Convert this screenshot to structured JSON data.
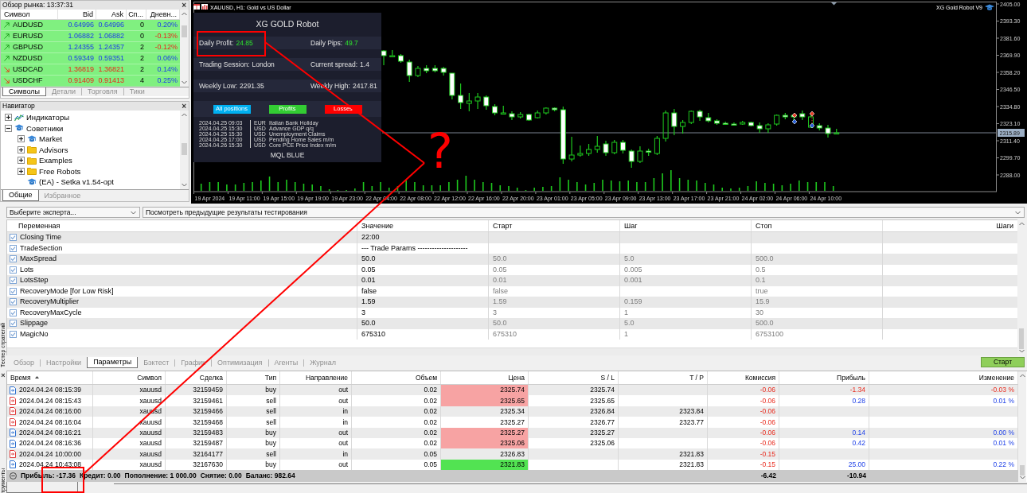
{
  "market_watch": {
    "title": "Обзор рынка: 13:37:31",
    "close": "×",
    "columns": [
      "Символ",
      "Bid",
      "Ask",
      "Сп...",
      "Дневн..."
    ],
    "rows": [
      {
        "rising": true,
        "symbol": "AUDUSD",
        "bid": "0.64996",
        "ask": "0.64996",
        "spread": "0",
        "change": "0.20%",
        "change_negative": false
      },
      {
        "rising": true,
        "symbol": "EURUSD",
        "bid": "1.06882",
        "ask": "1.06882",
        "spread": "0",
        "change": "-0.13%",
        "change_negative": true
      },
      {
        "rising": true,
        "symbol": "GBPUSD",
        "bid": "1.24355",
        "ask": "1.24357",
        "spread": "2",
        "change": "-0.12%",
        "change_negative": true
      },
      {
        "rising": true,
        "symbol": "NZDUSD",
        "bid": "0.59349",
        "ask": "0.59351",
        "spread": "2",
        "change": "0.06%",
        "change_negative": false
      },
      {
        "rising": false,
        "symbol": "USDCAD",
        "bid": "1.36819",
        "ask": "1.36821",
        "spread": "2",
        "change": "0.14%",
        "change_negative": false
      },
      {
        "rising": false,
        "symbol": "USDCHF",
        "bid": "0.91409",
        "ask": "0.91413",
        "spread": "4",
        "change": "0.25%",
        "change_negative": false
      }
    ],
    "tabs": [
      {
        "label": "Символы",
        "selected": true
      },
      {
        "label": "Детали",
        "selected": false
      },
      {
        "label": "Торговля",
        "selected": false
      },
      {
        "label": "Тики",
        "selected": false
      }
    ]
  },
  "navigator": {
    "title": "Навигатор",
    "close": "×",
    "tree": [
      {
        "label": "Индикаторы",
        "kind": "indicators",
        "expanded": false
      },
      {
        "label": "Советники",
        "kind": "experts",
        "expanded": true,
        "children": [
          {
            "label": "Market",
            "kind": "experts",
            "expanded": false
          },
          {
            "label": "Advisors",
            "kind": "folder",
            "expanded": false
          },
          {
            "label": "Examples",
            "kind": "folder",
            "expanded": false
          },
          {
            "label": "Free Robots",
            "kind": "folder",
            "expanded": false
          },
          {
            "label": "(EA) - Setka v1.54-opt",
            "kind": "experts"
          }
        ]
      }
    ],
    "tabs": [
      {
        "label": "Общие",
        "selected": true
      },
      {
        "label": "Избранное",
        "selected": false
      }
    ]
  },
  "chart": {
    "title": "XAUUSD, H1: Gold vs US Dollar",
    "expert": "XG Gold Robot V9",
    "price_labels": [
      "2405.00",
      "2393.30",
      "2381.60",
      "2369.90",
      "2358.20",
      "2346.50",
      "2334.80",
      "2323.10",
      "2311.40",
      "2299.70",
      "2288.00"
    ],
    "current_price": "2315.89",
    "time_labels": [
      "19 Apr 2024",
      "19 Apr 11:00",
      "19 Apr 15:00",
      "19 Apr 19:00",
      "19 Apr 23:00",
      "22 Apr 04:00",
      "22 Apr 08:00",
      "22 Apr 12:00",
      "22 Apr 16:00",
      "22 Apr 20:00",
      "23 Apr 01:00",
      "23 Apr 05:00",
      "23 Apr 09:00",
      "23 Apr 13:00",
      "23 Apr 17:00",
      "23 Apr 21:00",
      "24 Apr 02:00",
      "24 Apr 06:00",
      "24 Apr 10:00"
    ],
    "robot_panel": {
      "title": "XG GOLD Robot",
      "stats": [
        [
          {
            "label": "Daily Profit:",
            "value": "24.85",
            "accent": true
          },
          {
            "label": "Daily Pips:",
            "value": "49.7",
            "accent": true
          }
        ],
        [
          {
            "label": "Trading Session:",
            "value": "London",
            "accent": false
          },
          {
            "label": "Current spread:",
            "value": "1.4",
            "accent": false
          }
        ],
        [
          {
            "label": "Weekly Low:",
            "value": "2291.35",
            "accent": false
          },
          {
            "label": "Weekly High:",
            "value": "2417.81",
            "accent": false
          }
        ]
      ],
      "buttons": [
        {
          "label": "All positions",
          "color": "#00b0f0"
        },
        {
          "label": "Profits",
          "color": "#33cc33"
        },
        {
          "label": "Losses",
          "color": "#ff0000"
        }
      ],
      "news": [
        {
          "time": "2024.04.25 09:03",
          "currency": "EUR",
          "event": "Italian Bank Holiday"
        },
        {
          "time": "2024.04.25 15:30",
          "currency": "USD",
          "event": "Advance GDP q/q"
        },
        {
          "time": "2024.04.25 15:30",
          "currency": "USD",
          "event": "Unemployment Claims"
        },
        {
          "time": "2024.04.25 17:00",
          "currency": "USD",
          "event": "Pending Home Sales m/m"
        },
        {
          "time": "2024.04.26 15:30",
          "currency": "USD",
          "event": "Core PCE Price Index m/m"
        }
      ],
      "footer": "MQL BLUE"
    }
  },
  "tester": {
    "side_label": "Тестер стратегий",
    "expert_select": "Выберите эксперта...",
    "results_select": "Посмотреть предыдущие результаты тестирования",
    "columns": [
      "Переменная",
      "Значение",
      "Старт",
      "Шаг",
      "Стоп",
      "Шаги"
    ],
    "params": [
      {
        "name": "Closing Time",
        "checked": true,
        "value": "22:00"
      },
      {
        "name": "TradeSection",
        "checked": true,
        "value": "--- Trade Params ---------------------"
      },
      {
        "name": "MaxSpread",
        "checked": true,
        "value": "50.0",
        "start": "50.0",
        "step": "5.0",
        "stop": "500.0"
      },
      {
        "name": "Lots",
        "checked": true,
        "value": "0.05",
        "start": "0.05",
        "step": "0.005",
        "stop": "0.5"
      },
      {
        "name": "LotsStep",
        "checked": true,
        "value": "0.01",
        "start": "0.01",
        "step": "0.001",
        "stop": "0.1"
      },
      {
        "name": "RecoveryMode [for Low Risk]",
        "checked": true,
        "value": "false",
        "start": "false",
        "stop": "true"
      },
      {
        "name": "RecoveryMultiplier",
        "checked": true,
        "value": "1.59",
        "start": "1.59",
        "step": "0.159",
        "stop": "15.9"
      },
      {
        "name": "RecoveryMaxCycle",
        "checked": true,
        "value": "3",
        "start": "3",
        "step": "1",
        "stop": "30"
      },
      {
        "name": "Slippage",
        "checked": true,
        "value": "50.0",
        "start": "50.0",
        "step": "5.0",
        "stop": "500.0"
      },
      {
        "name": "MagicNo",
        "checked": true,
        "value": "675310",
        "start": "675310",
        "step": "1",
        "stop": "6753100"
      }
    ],
    "tabs": [
      {
        "label": "Обзор",
        "selected": false
      },
      {
        "label": "Настройки",
        "selected": false
      },
      {
        "label": "Параметры",
        "selected": true
      },
      {
        "label": "Бэктест",
        "selected": false
      },
      {
        "label": "График",
        "selected": false
      },
      {
        "label": "Оптимизация",
        "selected": false
      },
      {
        "label": "Агенты",
        "selected": false
      },
      {
        "label": "Журнал",
        "selected": false
      }
    ],
    "start_button": "Старт"
  },
  "trades": {
    "close": "×",
    "side_label": "трументы",
    "columns": [
      {
        "label": "Время",
        "sorted": true
      },
      {
        "label": "Символ",
        "sorted": false
      },
      {
        "label": "Сделка",
        "sorted": false
      },
      {
        "label": "Тип",
        "sorted": false
      },
      {
        "label": "Направление",
        "sorted": false
      },
      {
        "label": "Объем",
        "sorted": false
      },
      {
        "label": "Цена",
        "sorted": false
      },
      {
        "label": "S / L",
        "sorted": false
      },
      {
        "label": "T / P",
        "sorted": false
      },
      {
        "label": "Комиссия",
        "sorted": false
      },
      {
        "label": "Прибыль",
        "sorted": false
      },
      {
        "label": "Изменение",
        "sorted": false
      }
    ],
    "rows": [
      {
        "kind": "buy",
        "time": "2024.04.24 08:15:39",
        "symbol": "xauusd",
        "deal": "32159459",
        "type": "buy",
        "direction": "out",
        "volume": "0.02",
        "price": {
          "value": "2325.74",
          "color": "#f7a3a3"
        },
        "sl": "2325.74",
        "commission": "-0.06",
        "profit": "-1.34",
        "profit_negative": true,
        "change": "-0.03 %",
        "change_negative": true
      },
      {
        "kind": "sell",
        "time": "2024.04.24 08:15:43",
        "symbol": "xauusd",
        "deal": "32159461",
        "type": "sell",
        "direction": "out",
        "volume": "0.02",
        "price": {
          "value": "2325.65",
          "color": "#f7a3a3"
        },
        "sl": "2325.65",
        "commission": "-0.06",
        "profit": "0.28",
        "profit_negative": false,
        "change": "0.01 %",
        "change_negative": false
      },
      {
        "kind": "sell",
        "time": "2024.04.24 08:16:00",
        "symbol": "xauusd",
        "deal": "32159466",
        "type": "sell",
        "direction": "in",
        "volume": "0.02",
        "price": {
          "value": "2325.34"
        },
        "sl": "2326.84",
        "tp": "2323.84",
        "commission": "-0.06"
      },
      {
        "kind": "sell",
        "time": "2024.04.24 08:16:04",
        "symbol": "xauusd",
        "deal": "32159468",
        "type": "sell",
        "direction": "in",
        "volume": "0.02",
        "price": {
          "value": "2325.27"
        },
        "sl": "2326.77",
        "tp": "2323.77",
        "commission": "-0.06"
      },
      {
        "kind": "buy",
        "time": "2024.04.24 08:16:21",
        "symbol": "xauusd",
        "deal": "32159483",
        "type": "buy",
        "direction": "out",
        "volume": "0.02",
        "price": {
          "value": "2325.27",
          "color": "#f7a3a3"
        },
        "sl": "2325.27",
        "commission": "-0.06",
        "profit": "0.14",
        "profit_negative": false,
        "change": "0.00 %",
        "change_negative": false
      },
      {
        "kind": "buy",
        "time": "2024.04.24 08:16:36",
        "symbol": "xauusd",
        "deal": "32159487",
        "type": "buy",
        "direction": "out",
        "volume": "0.02",
        "price": {
          "value": "2325.06",
          "color": "#f7a3a3"
        },
        "sl": "2325.06",
        "commission": "-0.06",
        "profit": "0.42",
        "profit_negative": false,
        "change": "0.01 %",
        "change_negative": false
      },
      {
        "kind": "sell",
        "time": "2024.04.24 10:00:00",
        "symbol": "xauusd",
        "deal": "32164177",
        "type": "sell",
        "direction": "in",
        "volume": "0.05",
        "price": {
          "value": "2326.83"
        },
        "tp": "2321.83",
        "commission": "-0.15"
      },
      {
        "kind": "buy",
        "time": "2024.04.24 10:43:08",
        "symbol": "xauusd",
        "deal": "32167630",
        "type": "buy",
        "direction": "out",
        "volume": "0.05",
        "price": {
          "value": "2321.83",
          "color": "#52e352"
        },
        "tp": "2321.83",
        "commission": "-0.15",
        "profit": "25.00",
        "profit_negative": false,
        "change": "0.22 %",
        "change_negative": false
      }
    ],
    "summary": {
      "items": [
        "Прибыль: -17.36",
        "Кредит: 0.00",
        "Пополнение: 1 000.00",
        "Снятие: 0.00",
        "Баланс: 982.64"
      ],
      "commission": "-6.42",
      "profit": "-10.94"
    }
  },
  "annotations": {
    "question_mark": "?"
  }
}
